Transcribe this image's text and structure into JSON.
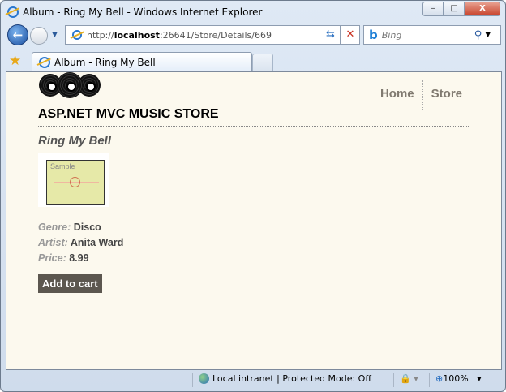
{
  "window": {
    "title": "Album - Ring My Bell - Windows Internet Explorer",
    "minimize": "–",
    "maximize": "□",
    "close": "X"
  },
  "navbar": {
    "url_prefix": "http://",
    "url_host": "localhost",
    "url_rest": ":26641/Store/Details/669",
    "search_placeholder": "Bing"
  },
  "tabs": [
    {
      "label": "Album - Ring My Bell"
    }
  ],
  "page": {
    "store_title": "ASP.NET MVC MUSIC STORE",
    "menu": [
      {
        "label": "Home"
      },
      {
        "label": "Store"
      }
    ],
    "album_title": "Ring My Bell",
    "album_art_label": "Sample",
    "genre_label": "Genre:",
    "genre": "Disco",
    "artist_label": "Artist:",
    "artist": "Anita Ward",
    "price_label": "Price:",
    "price": "8.99",
    "add_to_cart": "Add to cart"
  },
  "statusbar": {
    "zone": "Local intranet | Protected Mode: Off",
    "zoom": "100%"
  }
}
